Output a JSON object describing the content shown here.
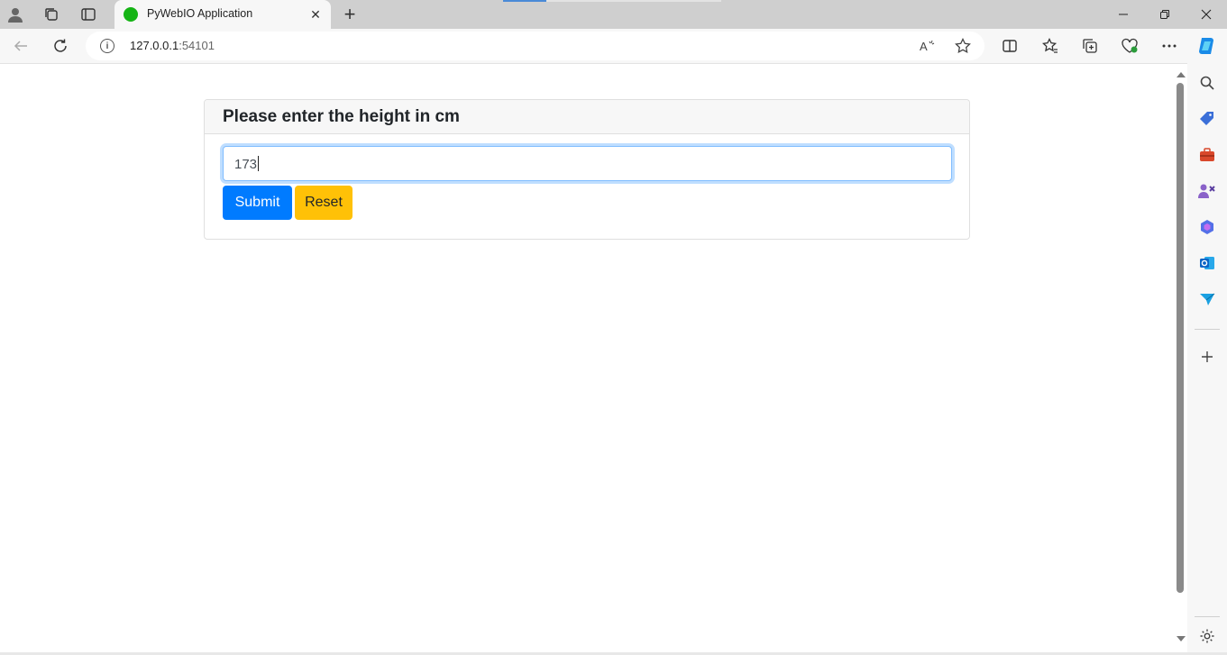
{
  "browser": {
    "tab": {
      "title": "PyWebIO Application"
    },
    "address": {
      "host": "127.0.0.1",
      "port": ":54101"
    }
  },
  "form": {
    "title": "Please enter the height in cm",
    "input_value": "173",
    "submit_label": "Submit",
    "reset_label": "Reset"
  },
  "colors": {
    "submit": "#007bff",
    "reset": "#ffc107",
    "favicon": "#15b415"
  }
}
